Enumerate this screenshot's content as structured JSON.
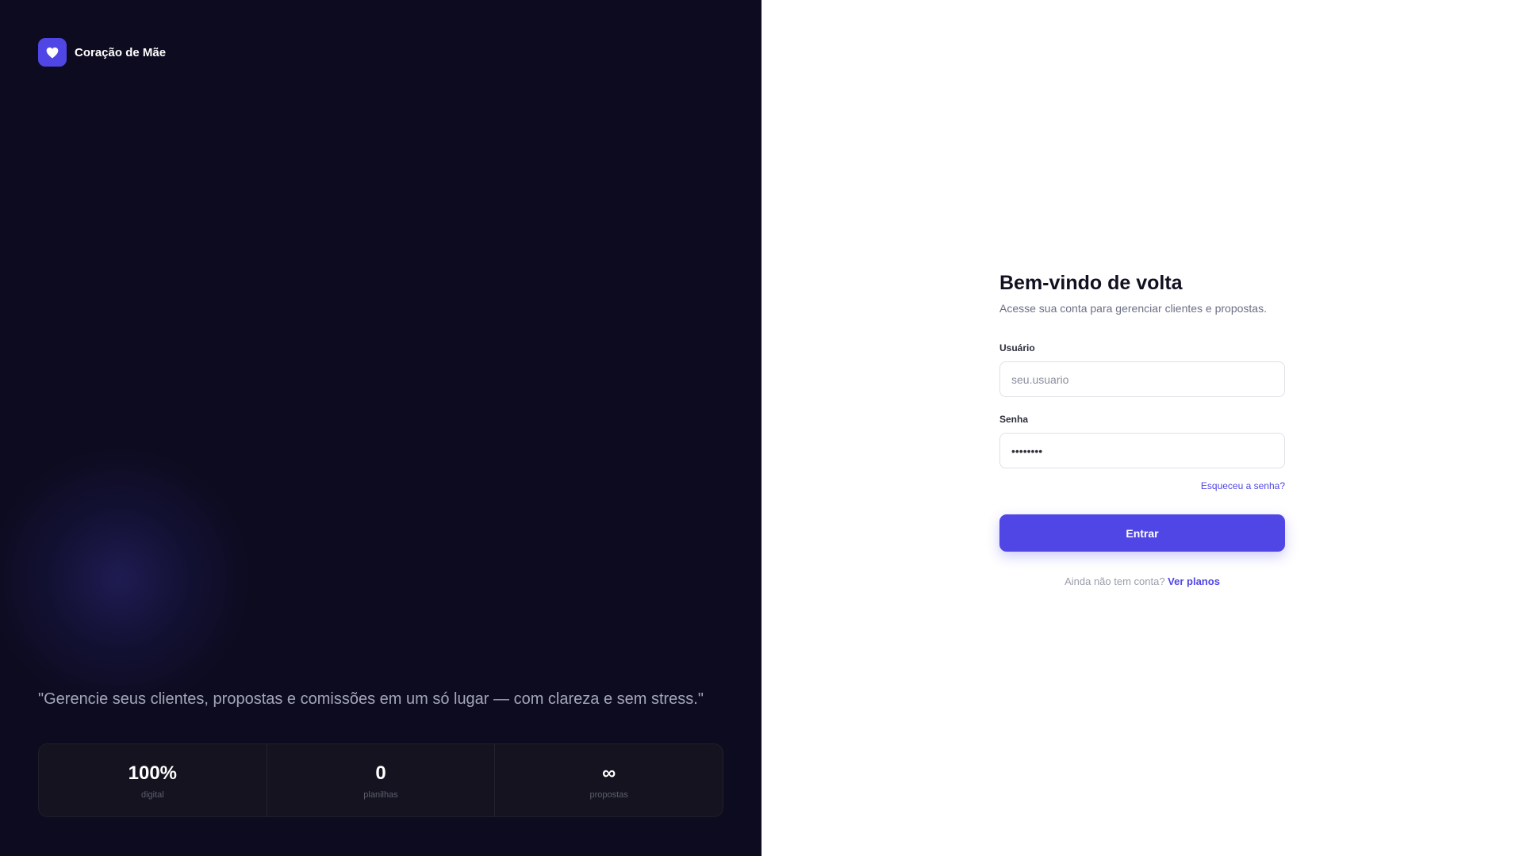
{
  "brand": {
    "name": "Coração de Mãe",
    "logo_icon": "heart-icon",
    "accent_color": "#5046e5"
  },
  "left_panel": {
    "quote": "\"Gerencie seus clientes, propostas e comissões em um só lugar — com clareza e sem stress.\"",
    "stats": [
      {
        "value": "100%",
        "label": "digital"
      },
      {
        "value": "0",
        "label": "planilhas"
      },
      {
        "value": "∞",
        "label": "propostas"
      }
    ]
  },
  "login": {
    "title": "Bem-vindo de volta",
    "subtitle": "Acesse sua conta para gerenciar clientes e propostas.",
    "username_label": "Usuário",
    "username_placeholder": "seu.usuario",
    "username_value": "",
    "password_label": "Senha",
    "password_value": "••••••••",
    "forgot_link": "Esqueceu a senha?",
    "submit_label": "Entrar",
    "signup_prompt": "Ainda não tem conta?",
    "signup_link": "Ver planos"
  }
}
